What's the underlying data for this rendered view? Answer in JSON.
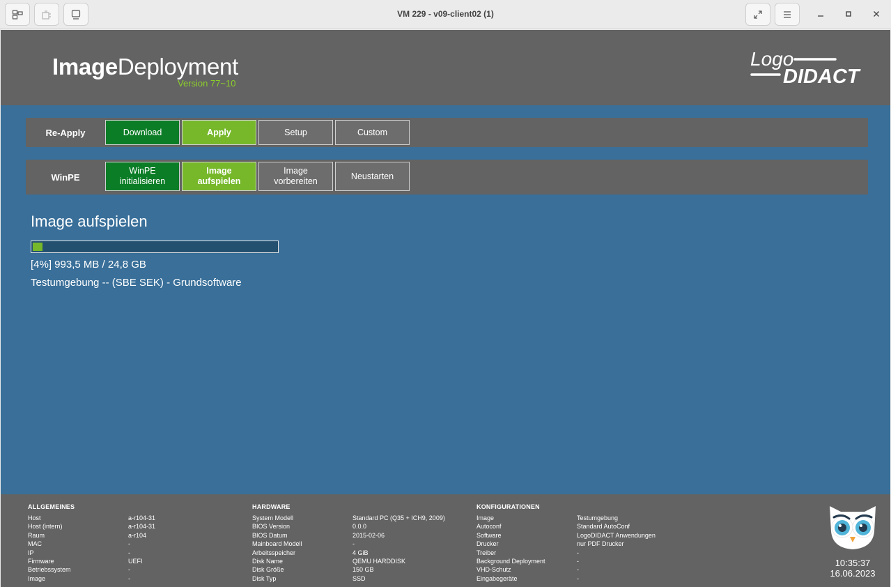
{
  "window": {
    "title": "VM 229 - v09-client02 (1)",
    "toolbar_icons": [
      "windows-icon",
      "usb-icon",
      "display-icon"
    ],
    "right_icons": [
      "fullscreen-icon",
      "menu-icon",
      "minimize-icon",
      "maximize-icon",
      "close-icon"
    ]
  },
  "header": {
    "logo_bold": "Image",
    "logo_light": "Deployment",
    "version": "Version 77~10",
    "brand_line1": "Logo",
    "brand_line2": "DIDACT"
  },
  "rows": {
    "reapply": {
      "label": "Re-Apply",
      "buttons": [
        "Download",
        "Apply",
        "Setup",
        "Custom"
      ]
    },
    "winpe": {
      "label": "WinPE",
      "buttons": [
        {
          "line1": "WinPE",
          "line2": "initialisieren"
        },
        {
          "line1": "Image",
          "line2": "aufspielen"
        },
        {
          "line1": "Image",
          "line2": "vorbereiten"
        },
        {
          "line1": "Neustarten",
          "line2": ""
        }
      ]
    }
  },
  "main": {
    "title": "Image aufspielen",
    "progress_percent": 4,
    "progress_text": "[4%] 993,5 MB / 24,8 GB",
    "image_name": "Testumgebung -- (SBE SEK) - Grundsoftware"
  },
  "footer": {
    "allgemeines": {
      "heading": "ALLGEMEINES",
      "rows": [
        [
          "Host",
          "a-r104-31"
        ],
        [
          "Host (intern)",
          "a-r104-31"
        ],
        [
          "Raum",
          "a-r104"
        ],
        [
          "MAC",
          "-"
        ],
        [
          "IP",
          "-"
        ],
        [
          "Firmware",
          "UEFI"
        ],
        [
          "Betriebssystem",
          "-"
        ],
        [
          "Image",
          "-"
        ]
      ]
    },
    "hardware": {
      "heading": "HARDWARE",
      "rows": [
        [
          "System Modell",
          "Standard PC (Q35 + ICH9, 2009)"
        ],
        [
          "BIOS Version",
          "0.0.0"
        ],
        [
          "BIOS Datum",
          "2015-02-06"
        ],
        [
          "Mainboard Modell",
          "-"
        ],
        [
          "Arbeitsspeicher",
          "4 GiB"
        ],
        [
          "Disk Name",
          "QEMU HARDDISK"
        ],
        [
          "Disk Größe",
          "150 GB"
        ],
        [
          "Disk Typ",
          "SSD"
        ]
      ]
    },
    "konfigurationen": {
      "heading": "KONFIGURATIONEN",
      "rows": [
        [
          "Image",
          "Testumgebung"
        ],
        [
          "Autoconf",
          "Standard AutoConf"
        ],
        [
          "Software",
          "LogoDIDACT Anwendungen"
        ],
        [
          "Drucker",
          "nur PDF Drucker"
        ],
        [
          "Treiber",
          "-"
        ],
        [
          "Background Deployment",
          "-"
        ],
        [
          "VHD-Schutz",
          "-"
        ],
        [
          "Eingabegeräte",
          "-"
        ]
      ]
    },
    "time": "10:35:37",
    "date": "16.06.2023"
  },
  "colors": {
    "header_bg": "#636363",
    "main_bg": "#396f99",
    "accent_green": "#76b82a",
    "dark_green": "#0c7d27",
    "button_gray": "#6d6d6d"
  }
}
